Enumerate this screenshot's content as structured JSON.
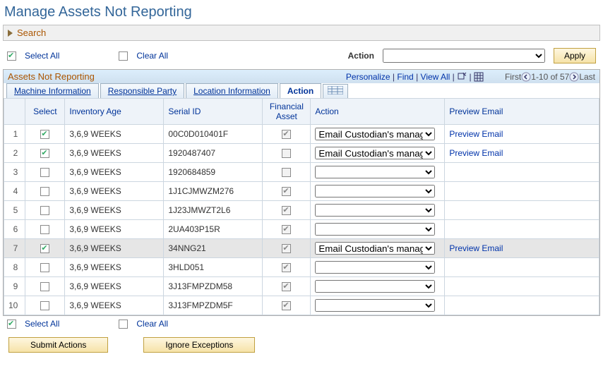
{
  "page": {
    "title": "Manage Assets Not Reporting"
  },
  "search": {
    "label": "Search"
  },
  "controls": {
    "selectAll": "Select All",
    "clearAll": "Clear All",
    "actionLabel": "Action",
    "apply": "Apply"
  },
  "panel": {
    "title": "Assets Not Reporting",
    "links": {
      "personalize": "Personalize",
      "find": "Find",
      "viewAll": "View All"
    },
    "nav": {
      "first": "First",
      "range": "1-10 of 57",
      "last": "Last"
    }
  },
  "tabs": {
    "t1": "Machine Information",
    "t2": "Responsible Party",
    "t3": "Location Information",
    "t4": "Action"
  },
  "columns": {
    "num": " ",
    "select": "Select",
    "age": "Inventory Age",
    "serial": "Serial ID",
    "fin": "Financial Asset",
    "action": "Action",
    "preview": "Preview Email"
  },
  "rows": [
    {
      "n": "1",
      "sel": true,
      "age": "3,6,9 WEEKS",
      "serial": "00C0D010401F",
      "fin": true,
      "action": "Email Custodian's manager",
      "preview": "Preview Email",
      "hl": false
    },
    {
      "n": "2",
      "sel": true,
      "age": "3,6,9 WEEKS",
      "serial": "1920487407",
      "fin": false,
      "action": "Email Custodian's manager",
      "preview": "Preview Email",
      "hl": false
    },
    {
      "n": "3",
      "sel": false,
      "age": "3,6,9 WEEKS",
      "serial": "1920684859",
      "fin": false,
      "action": "",
      "preview": "",
      "hl": false
    },
    {
      "n": "4",
      "sel": false,
      "age": "3,6,9 WEEKS",
      "serial": "1J1CJMWZM276",
      "fin": true,
      "action": "",
      "preview": "",
      "hl": false
    },
    {
      "n": "5",
      "sel": false,
      "age": "3,6,9 WEEKS",
      "serial": "1J23JMWZT2L6",
      "fin": true,
      "action": "",
      "preview": "",
      "hl": false
    },
    {
      "n": "6",
      "sel": false,
      "age": "3,6,9 WEEKS",
      "serial": "2UA403P15R",
      "fin": true,
      "action": "",
      "preview": "",
      "hl": false
    },
    {
      "n": "7",
      "sel": true,
      "age": "3,6,9 WEEKS",
      "serial": "34NNG21",
      "fin": true,
      "action": "Email Custodian's manager",
      "preview": "Preview Email",
      "hl": true
    },
    {
      "n": "8",
      "sel": false,
      "age": "3,6,9 WEEKS",
      "serial": "3HLD051",
      "fin": true,
      "action": "",
      "preview": "",
      "hl": false
    },
    {
      "n": "9",
      "sel": false,
      "age": "3,6,9 WEEKS",
      "serial": "3J13FMPZDM58",
      "fin": true,
      "action": "",
      "preview": "",
      "hl": false
    },
    {
      "n": "10",
      "sel": false,
      "age": "3,6,9 WEEKS",
      "serial": "3J13FMPZDM5F",
      "fin": true,
      "action": "",
      "preview": "",
      "hl": false
    }
  ],
  "bottom": {
    "submit": "Submit Actions",
    "ignore": "Ignore Exceptions"
  }
}
